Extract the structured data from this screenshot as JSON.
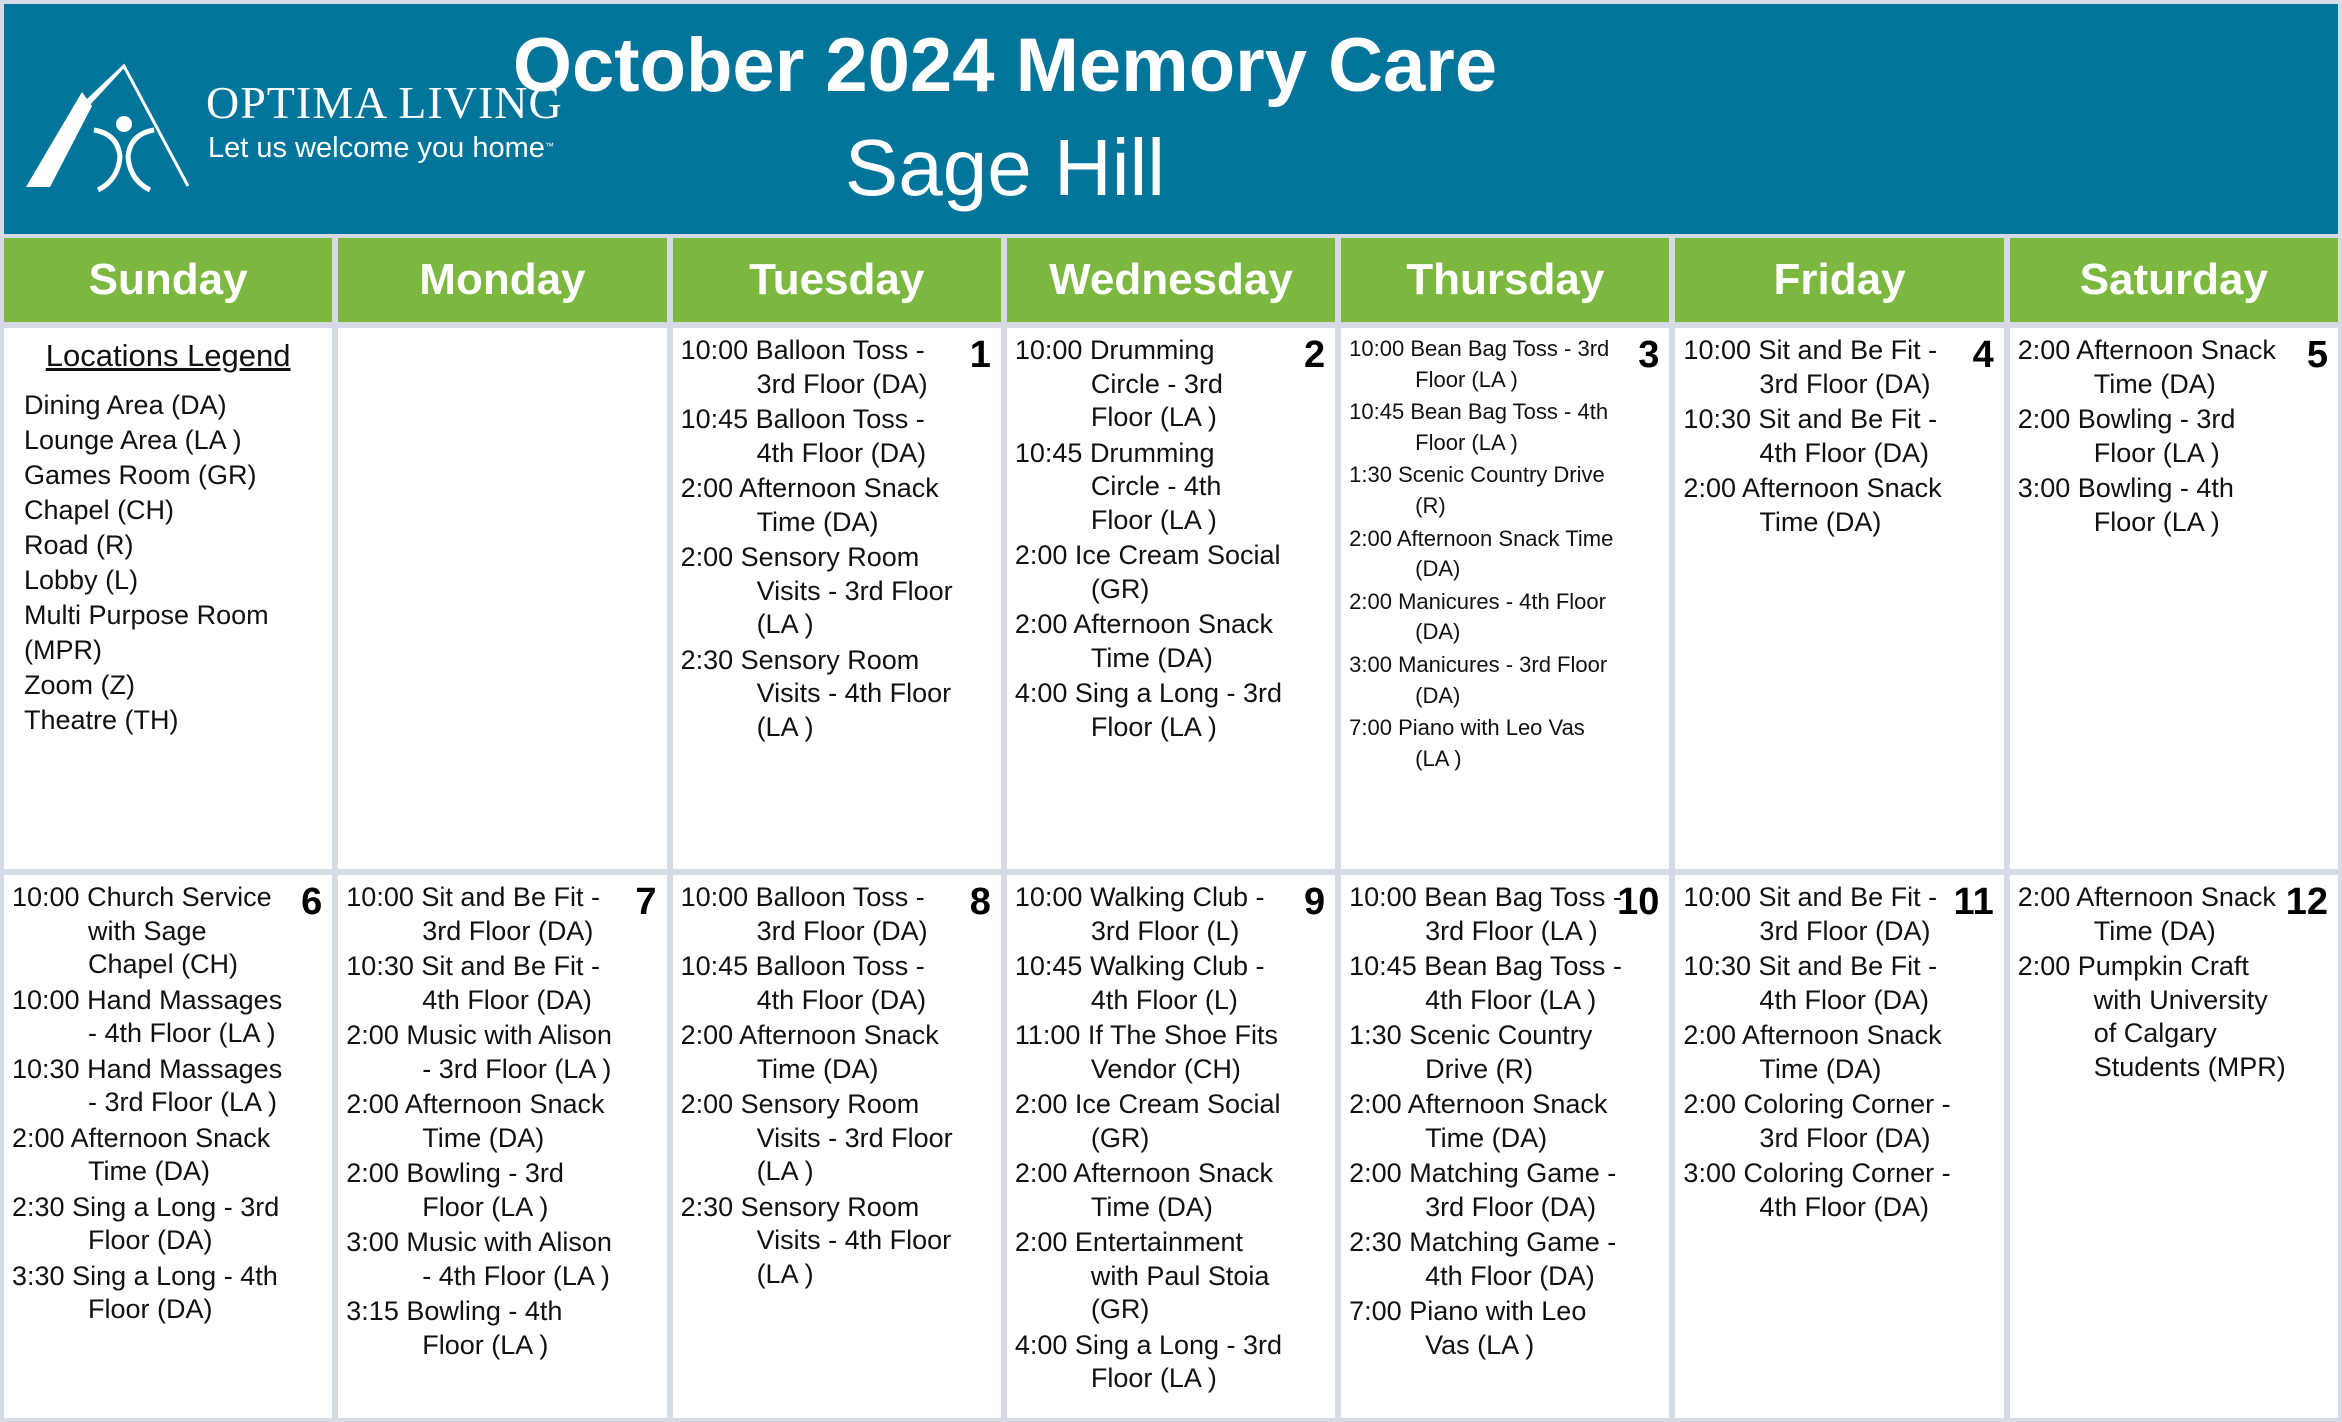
{
  "header": {
    "brand_name": "OPTIMA LIVING",
    "brand_tagline": "Let us welcome you home",
    "brand_tm": "™",
    "title": "October 2024 Memory Care",
    "subtitle": "Sage Hill"
  },
  "colors": {
    "header_bg": "#03749a",
    "dayhead_bg": "#7cb83f",
    "cell_bg": "#ffffff",
    "grid_line": "#d6dae4"
  },
  "days": [
    "Sunday",
    "Monday",
    "Tuesday",
    "Wednesday",
    "Thursday",
    "Friday",
    "Saturday"
  ],
  "legend": {
    "title": "Locations Legend",
    "items": [
      "Dining Area (DA)",
      "Lounge Area (LA )",
      "Games Room (GR)",
      "Chapel (CH)",
      "Road (R)",
      "Lobby (L)",
      "Multi Purpose Room (MPR)",
      "Zoom (Z)",
      "Theatre (TH)"
    ]
  },
  "weeks": [
    [
      {
        "legend": true
      },
      {
        "date": "",
        "events": []
      },
      {
        "date": "1",
        "events": [
          {
            "time": "10:00",
            "text": "Balloon Toss - 3rd Floor (DA)"
          },
          {
            "time": "10:45",
            "text": "Balloon Toss - 4th Floor (DA)"
          },
          {
            "time": "2:00",
            "text": "Afternoon Snack Time (DA)"
          },
          {
            "time": "2:00",
            "text": "Sensory Room Visits - 3rd Floor (LA )"
          },
          {
            "time": "2:30",
            "text": "Sensory Room Visits - 4th Floor (LA )"
          }
        ]
      },
      {
        "date": "2",
        "events": [
          {
            "time": "10:00",
            "text": "Drumming Circle - 3rd Floor (LA )"
          },
          {
            "time": "10:45",
            "text": "Drumming Circle - 4th Floor (LA )"
          },
          {
            "time": "2:00",
            "text": "Ice Cream Social (GR)"
          },
          {
            "time": "2:00",
            "text": "Afternoon Snack Time (DA)"
          },
          {
            "time": "4:00",
            "text": "Sing a Long - 3rd Floor (LA )"
          }
        ]
      },
      {
        "date": "3",
        "small": true,
        "events": [
          {
            "time": "10:00",
            "text": "Bean Bag Toss - 3rd Floor (LA )"
          },
          {
            "time": "10:45",
            "text": "Bean Bag Toss - 4th Floor (LA )"
          },
          {
            "time": "1:30",
            "text": "Scenic Country Drive (R)"
          },
          {
            "time": "2:00",
            "text": "Afternoon Snack Time (DA)"
          },
          {
            "time": "2:00",
            "text": "Manicures - 4th Floor (DA)"
          },
          {
            "time": "3:00",
            "text": "Manicures - 3rd Floor (DA)"
          },
          {
            "time": "7:00",
            "text": "Piano with Leo Vas (LA )"
          }
        ]
      },
      {
        "date": "4",
        "events": [
          {
            "time": "10:00",
            "text": "Sit and Be Fit - 3rd Floor (DA)"
          },
          {
            "time": "10:30",
            "text": "Sit and Be Fit - 4th Floor (DA)"
          },
          {
            "time": "2:00",
            "text": "Afternoon Snack Time (DA)"
          }
        ]
      },
      {
        "date": "5",
        "events": [
          {
            "time": "2:00",
            "text": "Afternoon Snack Time (DA)"
          },
          {
            "time": "2:00",
            "text": "Bowling - 3rd Floor (LA )"
          },
          {
            "time": "3:00",
            "text": "Bowling - 4th Floor (LA )"
          }
        ]
      }
    ],
    [
      {
        "date": "6",
        "events": [
          {
            "time": "10:00",
            "text": "Church Service with Sage Chapel (CH)"
          },
          {
            "time": "10:00",
            "text": "Hand Massages - 4th Floor (LA )"
          },
          {
            "time": "10:30",
            "text": "Hand Massages - 3rd Floor (LA )"
          },
          {
            "time": "2:00",
            "text": "Afternoon Snack Time (DA)"
          },
          {
            "time": "2:30",
            "text": "Sing a Long - 3rd Floor (DA)"
          },
          {
            "time": "3:30",
            "text": "Sing a Long - 4th Floor (DA)"
          }
        ]
      },
      {
        "date": "7",
        "events": [
          {
            "time": "10:00",
            "text": "Sit and Be Fit - 3rd Floor (DA)"
          },
          {
            "time": "10:30",
            "text": "Sit and Be Fit - 4th Floor (DA)"
          },
          {
            "time": "2:00",
            "text": "Music with Alison - 3rd Floor (LA )"
          },
          {
            "time": "2:00",
            "text": "Afternoon Snack Time (DA)"
          },
          {
            "time": "2:00",
            "text": "Bowling - 3rd Floor (LA )"
          },
          {
            "time": "3:00",
            "text": "Music with Alison - 4th Floor (LA )"
          },
          {
            "time": "3:15",
            "text": "Bowling - 4th Floor (LA )"
          }
        ]
      },
      {
        "date": "8",
        "events": [
          {
            "time": "10:00",
            "text": "Balloon Toss - 3rd Floor (DA)"
          },
          {
            "time": "10:45",
            "text": "Balloon Toss - 4th Floor (DA)"
          },
          {
            "time": "2:00",
            "text": "Afternoon Snack Time (DA)"
          },
          {
            "time": "2:00",
            "text": "Sensory Room Visits - 3rd Floor (LA )"
          },
          {
            "time": "2:30",
            "text": "Sensory Room Visits - 4th Floor (LA )"
          }
        ]
      },
      {
        "date": "9",
        "events": [
          {
            "time": "10:00",
            "text": "Walking Club - 3rd Floor (L)"
          },
          {
            "time": "10:45",
            "text": "Walking Club - 4th Floor (L)"
          },
          {
            "time": "11:00",
            "text": "If The Shoe Fits Vendor (CH)"
          },
          {
            "time": "2:00",
            "text": "Ice Cream Social (GR)"
          },
          {
            "time": "2:00",
            "text": "Afternoon Snack Time (DA)"
          },
          {
            "time": "2:00",
            "text": "Entertainment with Paul Stoia (GR)"
          },
          {
            "time": "4:00",
            "text": "Sing a Long - 3rd Floor (LA )"
          }
        ]
      },
      {
        "date": "10",
        "events": [
          {
            "time": "10:00",
            "text": "Bean Bag Toss - 3rd Floor (LA )"
          },
          {
            "time": "10:45",
            "text": "Bean Bag Toss - 4th Floor (LA )"
          },
          {
            "time": "1:30",
            "text": "Scenic Country Drive (R)"
          },
          {
            "time": "2:00",
            "text": "Afternoon Snack Time (DA)"
          },
          {
            "time": "2:00",
            "text": "Matching Game - 3rd Floor (DA)"
          },
          {
            "time": "2:30",
            "text": "Matching Game - 4th Floor (DA)"
          },
          {
            "time": "7:00",
            "text": "Piano with Leo Vas (LA )"
          }
        ]
      },
      {
        "date": "11",
        "events": [
          {
            "time": "10:00",
            "text": "Sit and Be Fit - 3rd Floor (DA)"
          },
          {
            "time": "10:30",
            "text": "Sit and Be Fit - 4th Floor (DA)"
          },
          {
            "time": "2:00",
            "text": "Afternoon Snack Time (DA)"
          },
          {
            "time": "2:00",
            "text": "Coloring Corner - 3rd Floor (DA)"
          },
          {
            "time": "3:00",
            "text": "Coloring Corner - 4th Floor (DA)"
          }
        ]
      },
      {
        "date": "12",
        "events": [
          {
            "time": "2:00",
            "text": "Afternoon Snack Time (DA)"
          },
          {
            "time": "2:00",
            "text": "Pumpkin Craft with University of Calgary Students (MPR)"
          }
        ]
      }
    ]
  ]
}
